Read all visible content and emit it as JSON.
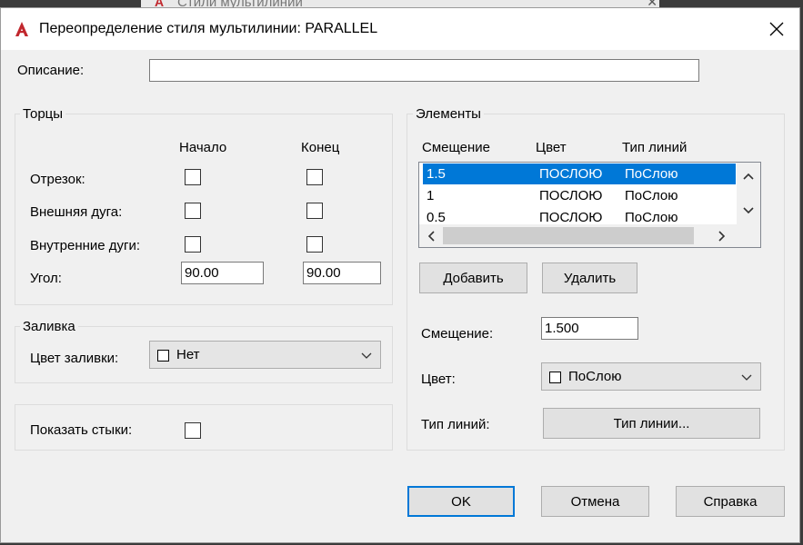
{
  "background_window": {
    "title": "Стили мультилинии"
  },
  "dialog": {
    "title": "Переопределение стиля мультилинии: PARALLEL"
  },
  "description": {
    "label": "Описание:",
    "value": ""
  },
  "caps": {
    "group_label": "Торцы",
    "col_start": "Начало",
    "col_end": "Конец",
    "rows": [
      {
        "label": "Отрезок:",
        "start": false,
        "end": false
      },
      {
        "label": "Внешняя дуга:",
        "start": false,
        "end": false
      },
      {
        "label": "Внутренние дуги:",
        "start": false,
        "end": false
      }
    ],
    "angle_label": "Угол:",
    "angle_start": "90.00",
    "angle_end": "90.00"
  },
  "fill": {
    "group_label": "Заливка",
    "color_label": "Цвет заливки:",
    "color_value": "Нет"
  },
  "show_joints": {
    "label": "Показать стыки:",
    "checked": false
  },
  "elements": {
    "group_label": "Элементы",
    "headers": {
      "offset": "Смещение",
      "color": "Цвет",
      "linetype": "Тип линий"
    },
    "rows": [
      {
        "offset": "1.5",
        "color": "ПОСЛОЮ",
        "linetype": "ПоСлою",
        "selected": true
      },
      {
        "offset": "1",
        "color": "ПОСЛОЮ",
        "linetype": "ПоСлою",
        "selected": false
      },
      {
        "offset": "0.5",
        "color": "ПОСЛОЮ",
        "linetype": "ПоСлою",
        "selected": false
      }
    ],
    "add_button": "Добавить",
    "delete_button": "Удалить",
    "offset_label": "Смещение:",
    "offset_value": "1.500",
    "color_label": "Цвет:",
    "color_value": "ПоСлою",
    "linetype_label": "Тип линий:",
    "linetype_button": "Тип линии..."
  },
  "buttons": {
    "ok": "OK",
    "cancel": "Отмена",
    "help": "Справка"
  },
  "colors": {
    "accent": "#0078d7",
    "app_icon": "#c1272d"
  }
}
